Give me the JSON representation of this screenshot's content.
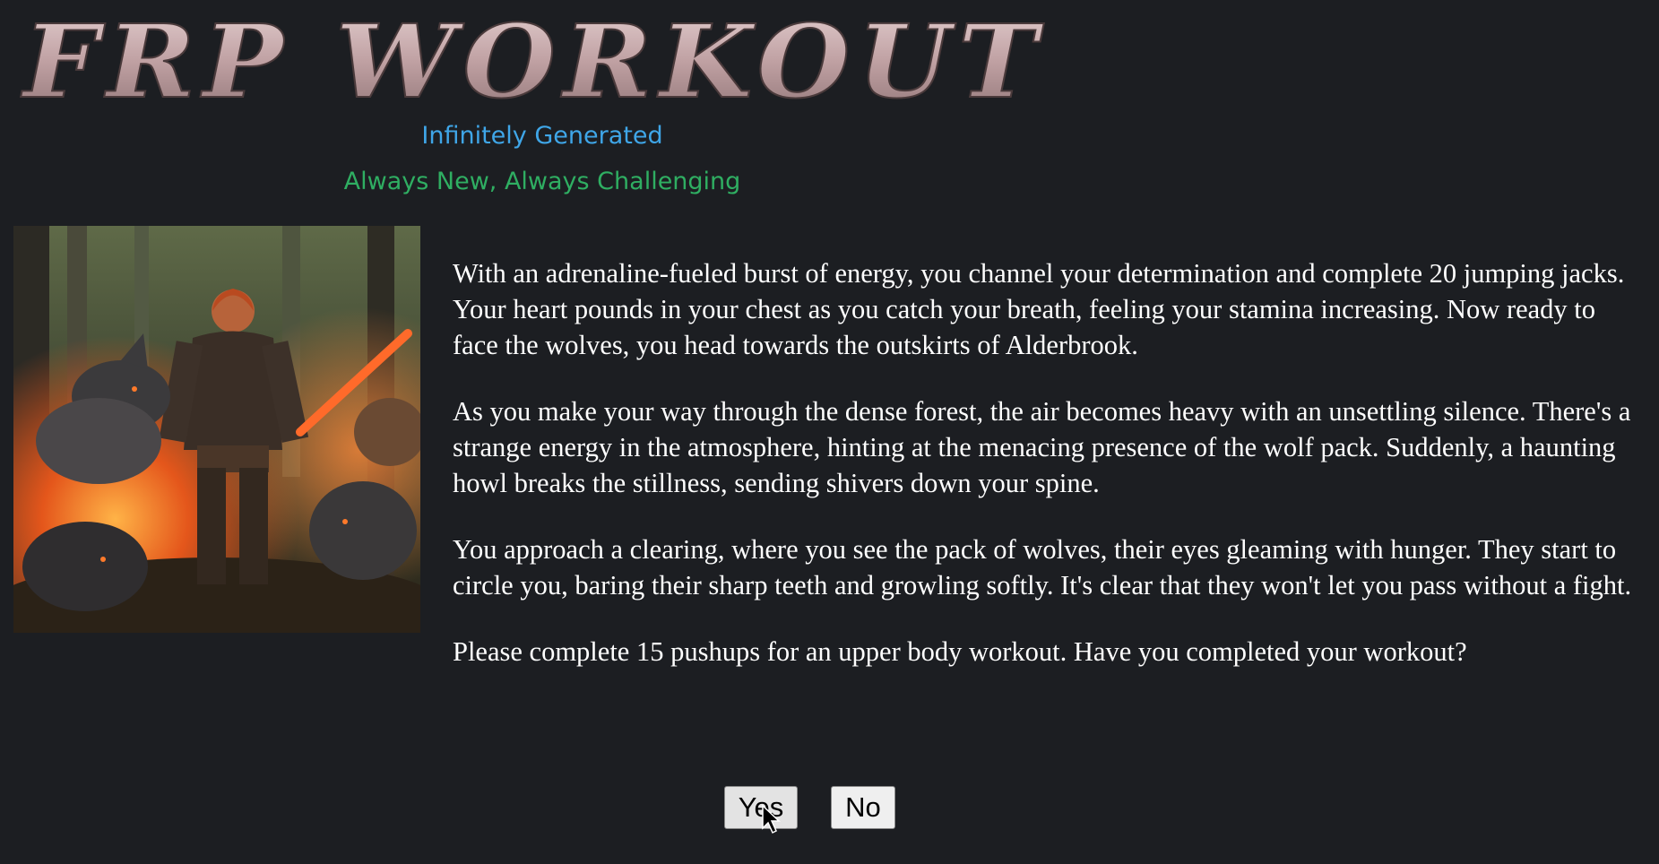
{
  "header": {
    "title": "FRP WORKOUT",
    "subtitle_1": "Infinitely Generated",
    "subtitle_2": "Always New, Always Challenging"
  },
  "illustration": {
    "alt": "Warrior surrounded by wolves in a forest with flames"
  },
  "story": {
    "paragraphs": [
      "With an adrenaline-fueled burst of energy, you channel your determination and complete 20 jumping jacks. Your heart pounds in your chest as you catch your breath, feeling your stamina increasing. Now ready to face the wolves, you head towards the outskirts of Alderbrook.",
      "As you make your way through the dense forest, the air becomes heavy with an unsettling silence. There's a strange energy in the atmosphere, hinting at the menacing presence of the wolf pack. Suddenly, a haunting howl breaks the stillness, sending shivers down your spine.",
      "You approach a clearing, where you see the pack of wolves, their eyes gleaming with hunger. They start to circle you, baring their sharp teeth and growling softly. It's clear that they won't let you pass without a fight.",
      "Please complete 15 pushups for an upper body workout. Have you completed your workout?"
    ]
  },
  "actions": {
    "yes_label": "Yes",
    "no_label": "No"
  },
  "colors": {
    "background": "#1c1e22",
    "subtitle_1": "#3fa6e8",
    "subtitle_2": "#2fae62",
    "title_stone": "#c9acae"
  }
}
